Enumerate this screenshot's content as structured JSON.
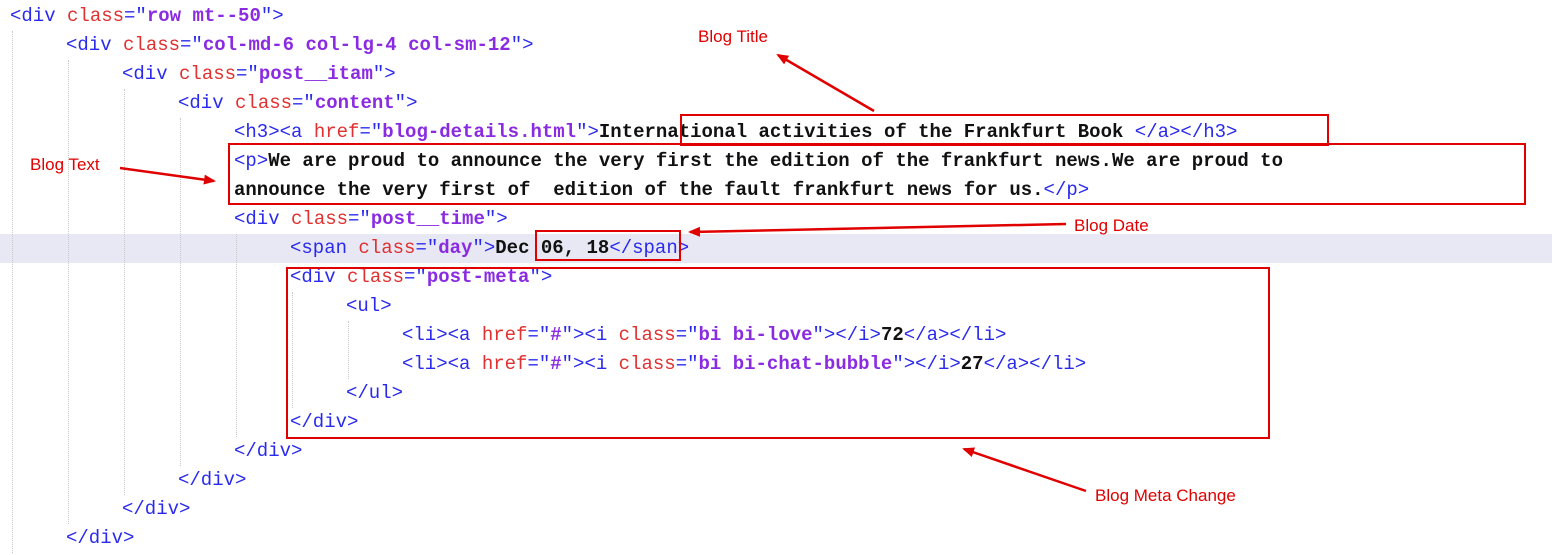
{
  "code": {
    "lines": [
      [
        [
          "d",
          "<div "
        ],
        [
          "k",
          "class"
        ],
        [
          "d",
          "=\""
        ],
        [
          "v",
          "row mt--50"
        ],
        [
          "d",
          "\">"
        ]
      ],
      [
        [
          "d",
          "<div "
        ],
        [
          "k",
          "class"
        ],
        [
          "d",
          "=\""
        ],
        [
          "v",
          "col-md-6 col-lg-4 col-sm-12"
        ],
        [
          "d",
          "\">"
        ]
      ],
      [
        [
          "d",
          "<div "
        ],
        [
          "k",
          "class"
        ],
        [
          "d",
          "=\""
        ],
        [
          "v",
          "post__itam"
        ],
        [
          "d",
          "\">"
        ]
      ],
      [
        [
          "d",
          "<div "
        ],
        [
          "k",
          "class"
        ],
        [
          "d",
          "=\""
        ],
        [
          "v",
          "content"
        ],
        [
          "d",
          "\">"
        ]
      ],
      [
        [
          "d",
          "<h3><a "
        ],
        [
          "k",
          "href"
        ],
        [
          "d",
          "=\""
        ],
        [
          "v",
          "blog-details.html"
        ],
        [
          "d",
          "\">"
        ],
        [
          "t",
          "International activities of the Frankfurt Book"
        ],
        [
          "d",
          " </a></h3>"
        ]
      ],
      [
        [
          "d",
          "<p>"
        ],
        [
          "t",
          "We are proud to announce the very first the edition of the frankfurt news.We are proud to"
        ]
      ],
      [
        [
          "t",
          "announce the very first of  edition of the fault frankfurt news for us."
        ],
        [
          "d",
          "</p>"
        ]
      ],
      [
        [
          "d",
          "<div "
        ],
        [
          "k",
          "class"
        ],
        [
          "d",
          "=\""
        ],
        [
          "v",
          "post__time"
        ],
        [
          "d",
          "\">"
        ]
      ],
      [
        [
          "d",
          "<span "
        ],
        [
          "k",
          "class"
        ],
        [
          "d",
          "=\""
        ],
        [
          "v",
          "day"
        ],
        [
          "d",
          "\">"
        ],
        [
          "t",
          "Dec 06, 18"
        ],
        [
          "d",
          "</span>"
        ]
      ],
      [
        [
          "d",
          "<div "
        ],
        [
          "k",
          "class"
        ],
        [
          "d",
          "=\""
        ],
        [
          "v",
          "post-meta"
        ],
        [
          "d",
          "\">"
        ]
      ],
      [
        [
          "d",
          "<ul>"
        ]
      ],
      [
        [
          "d",
          "<li><a "
        ],
        [
          "k",
          "href"
        ],
        [
          "d",
          "=\""
        ],
        [
          "v",
          "#"
        ],
        [
          "d",
          "\"><i "
        ],
        [
          "k",
          "class"
        ],
        [
          "d",
          "=\""
        ],
        [
          "v",
          "bi bi-love"
        ],
        [
          "d",
          "\"></i>"
        ],
        [
          "t",
          "72"
        ],
        [
          "d",
          "</a></li>"
        ]
      ],
      [
        [
          "d",
          "<li><a "
        ],
        [
          "k",
          "href"
        ],
        [
          "d",
          "=\""
        ],
        [
          "v",
          "#"
        ],
        [
          "d",
          "\"><i "
        ],
        [
          "k",
          "class"
        ],
        [
          "d",
          "=\""
        ],
        [
          "v",
          "bi bi-chat-bubble"
        ],
        [
          "d",
          "\"></i>"
        ],
        [
          "t",
          "27"
        ],
        [
          "d",
          "</a></li>"
        ]
      ],
      [
        [
          "d",
          "</ul>"
        ]
      ],
      [
        [
          "d",
          "</div>"
        ]
      ],
      [
        [
          "d",
          "</div>"
        ]
      ],
      [
        [
          "d",
          "</div>"
        ]
      ],
      [
        [
          "d",
          "</div>"
        ]
      ],
      [
        [
          "d",
          "</div>"
        ]
      ]
    ],
    "indents": [
      0,
      1,
      2,
      3,
      4,
      4,
      4,
      4,
      5,
      5,
      6,
      7,
      7,
      6,
      5,
      4,
      3,
      2,
      1
    ],
    "highlighted_line": 8
  },
  "annotations": {
    "blog_title": "Blog Title",
    "blog_text": "Blog Text",
    "blog_date": "Blog Date",
    "blog_meta": "Blog Meta Change"
  },
  "colors": {
    "delimiter": "#2a2aee",
    "attr_name": "#e03030",
    "attr_value": "#8a2be2",
    "text": "#111111",
    "annotation": "#e00000",
    "highlight": "#e8e8f4"
  }
}
